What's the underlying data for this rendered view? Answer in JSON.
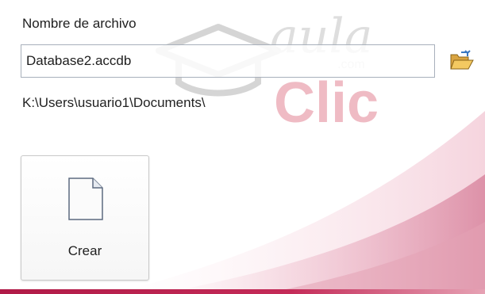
{
  "form": {
    "file_label": "Nombre de archivo",
    "file_value": "Database2.accdb",
    "path": "K:\\Users\\usuario1\\Documents\\"
  },
  "actions": {
    "create_label": "Crear"
  },
  "watermark": {
    "text_aula": "aula",
    "text_clic": "Clic",
    "text_com": ".com"
  },
  "icons": {
    "browse": "folder-open-icon",
    "create": "blank-document-icon"
  },
  "colors": {
    "accent": "#b01a47",
    "input_border": "#a8b0bb"
  }
}
